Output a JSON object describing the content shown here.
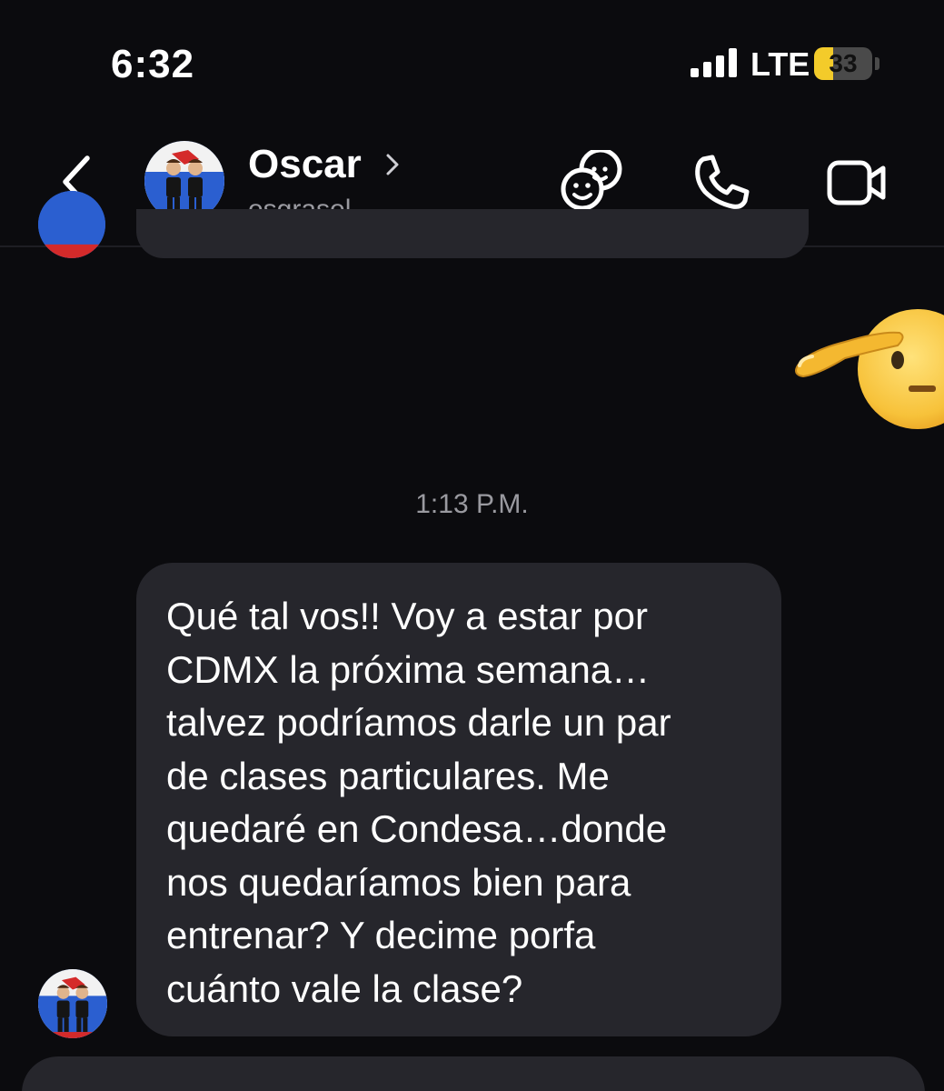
{
  "status_bar": {
    "time": "6:32",
    "network": "LTE",
    "battery_level": "33",
    "battery_fraction": 0.33
  },
  "header": {
    "contact_name": "Oscar",
    "contact_username": "osgrasol",
    "icons": [
      "back-chevron-icon",
      "chevron-right-icon",
      "theme-faces-icon",
      "phone-icon",
      "video-camera-icon"
    ]
  },
  "chat": {
    "emoji_message": "salute-emoji",
    "timestamp": "1:13 P.M.",
    "message": "Qué tal vos!! Voy a estar por\nCDMX la próxima semana…\ntalvez podríamos darle un par\nde clases particulares. Me\nquedaré en Condesa…donde\nnos quedaríamos bien para\nentrenar? Y decime porfa\ncuánto vale la clase?"
  },
  "colors": {
    "background": "#0b0b0e",
    "bubble": "#26262c",
    "secondary_text": "#9a9aa0",
    "battery_accent": "#f3cb2a"
  }
}
